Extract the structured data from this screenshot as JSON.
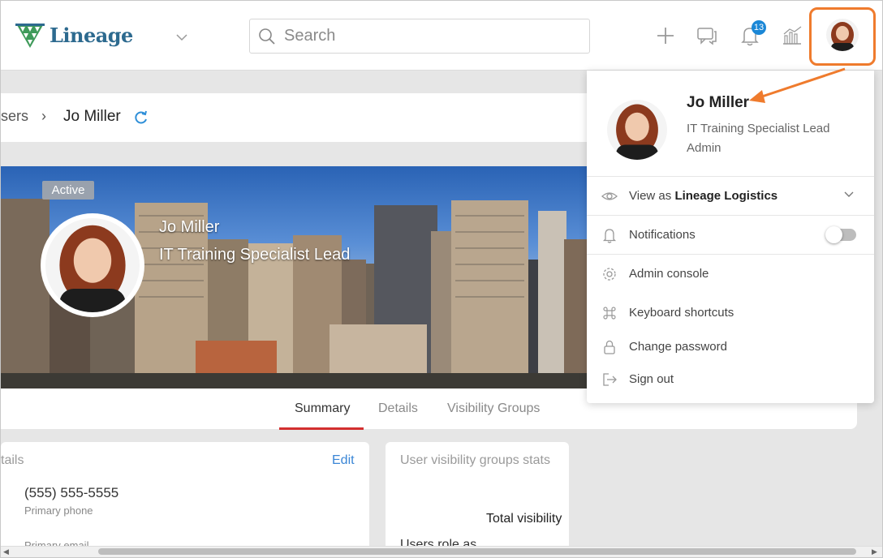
{
  "app": {
    "logo_text": "Lineage"
  },
  "search": {
    "placeholder": "Search"
  },
  "header": {
    "notification_count": "13",
    "accent_color": "#1b87d6",
    "highlight_color": "#ef7b2d"
  },
  "breadcrumb": {
    "parent": "sers",
    "separator": "›",
    "current": "Jo Miller"
  },
  "profile": {
    "status": "Active",
    "name": "Jo Miller",
    "title": "IT Training Specialist Lead"
  },
  "tabs": [
    {
      "label": "Summary",
      "active": true
    },
    {
      "label": "Details",
      "active": false
    },
    {
      "label": "Visibility Groups",
      "active": false
    }
  ],
  "details_card": {
    "heading": "tails",
    "edit_label": "Edit",
    "phone": "(555) 555-5555",
    "phone_label": "Primary phone",
    "email_label": "Primary email"
  },
  "visibility_card": {
    "heading": "User visibility groups stats",
    "total_label": "Total visibility",
    "users_role_label": "Users role as"
  },
  "menu": {
    "name": "Jo Miller",
    "title": "IT Training Specialist Lead",
    "role": "Admin",
    "view_as_prefix": "View as",
    "view_as_org": "Lineage Logistics",
    "notifications": "Notifications",
    "notifications_enabled": false,
    "admin_console": "Admin console",
    "keyboard_shortcuts": "Keyboard shortcuts",
    "change_password": "Change password",
    "sign_out": "Sign out"
  }
}
